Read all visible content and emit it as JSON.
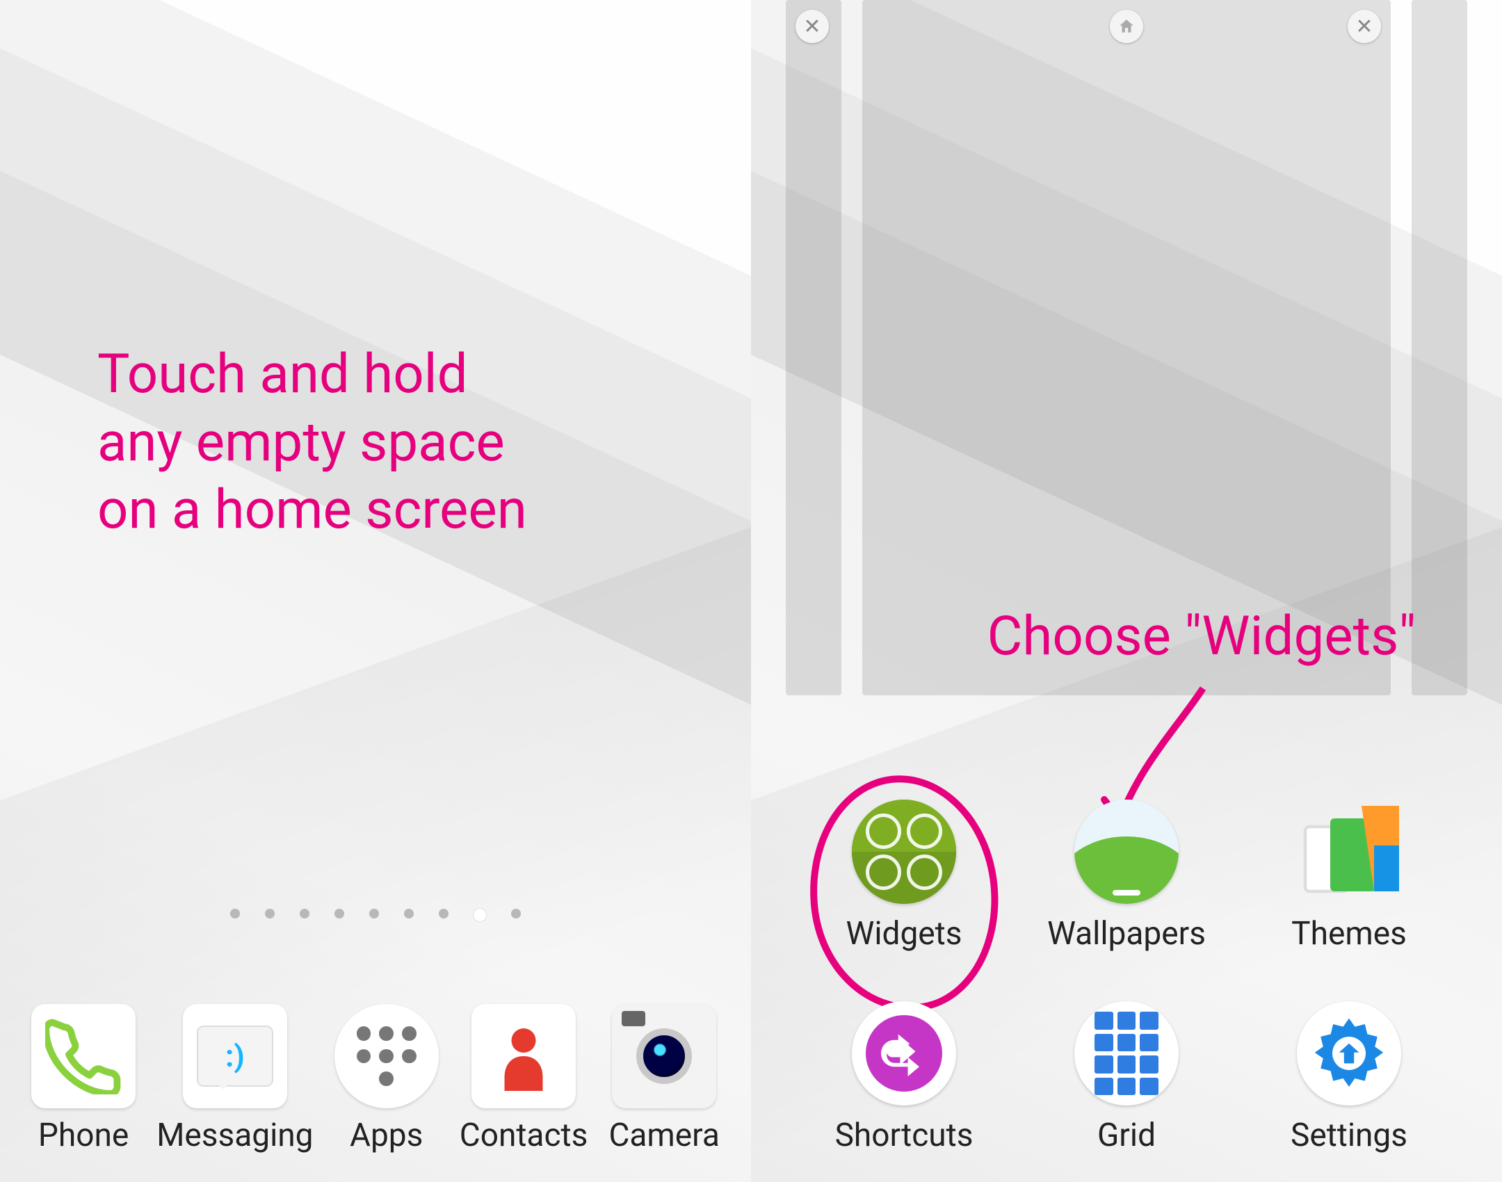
{
  "annotation_color": "#e6007e",
  "left": {
    "hint_lines": [
      "Touch and hold",
      "any empty space",
      "on a home screen"
    ],
    "page_count": 9,
    "active_page_index": 7,
    "dock": [
      {
        "id": "phone",
        "label": "Phone"
      },
      {
        "id": "messaging",
        "label": "Messaging"
      },
      {
        "id": "apps",
        "label": "Apps"
      },
      {
        "id": "contacts",
        "label": "Contacts"
      },
      {
        "id": "camera",
        "label": "Camera"
      }
    ]
  },
  "right": {
    "hint": "Choose \"Widgets\"",
    "options": [
      {
        "id": "widgets",
        "label": "Widgets",
        "highlighted": true
      },
      {
        "id": "wallpapers",
        "label": "Wallpapers",
        "highlighted": false
      },
      {
        "id": "themes",
        "label": "Themes",
        "highlighted": false
      },
      {
        "id": "shortcuts",
        "label": "Shortcuts",
        "highlighted": false
      },
      {
        "id": "grid",
        "label": "Grid",
        "highlighted": false
      },
      {
        "id": "settings",
        "label": "Settings",
        "highlighted": false
      }
    ]
  }
}
